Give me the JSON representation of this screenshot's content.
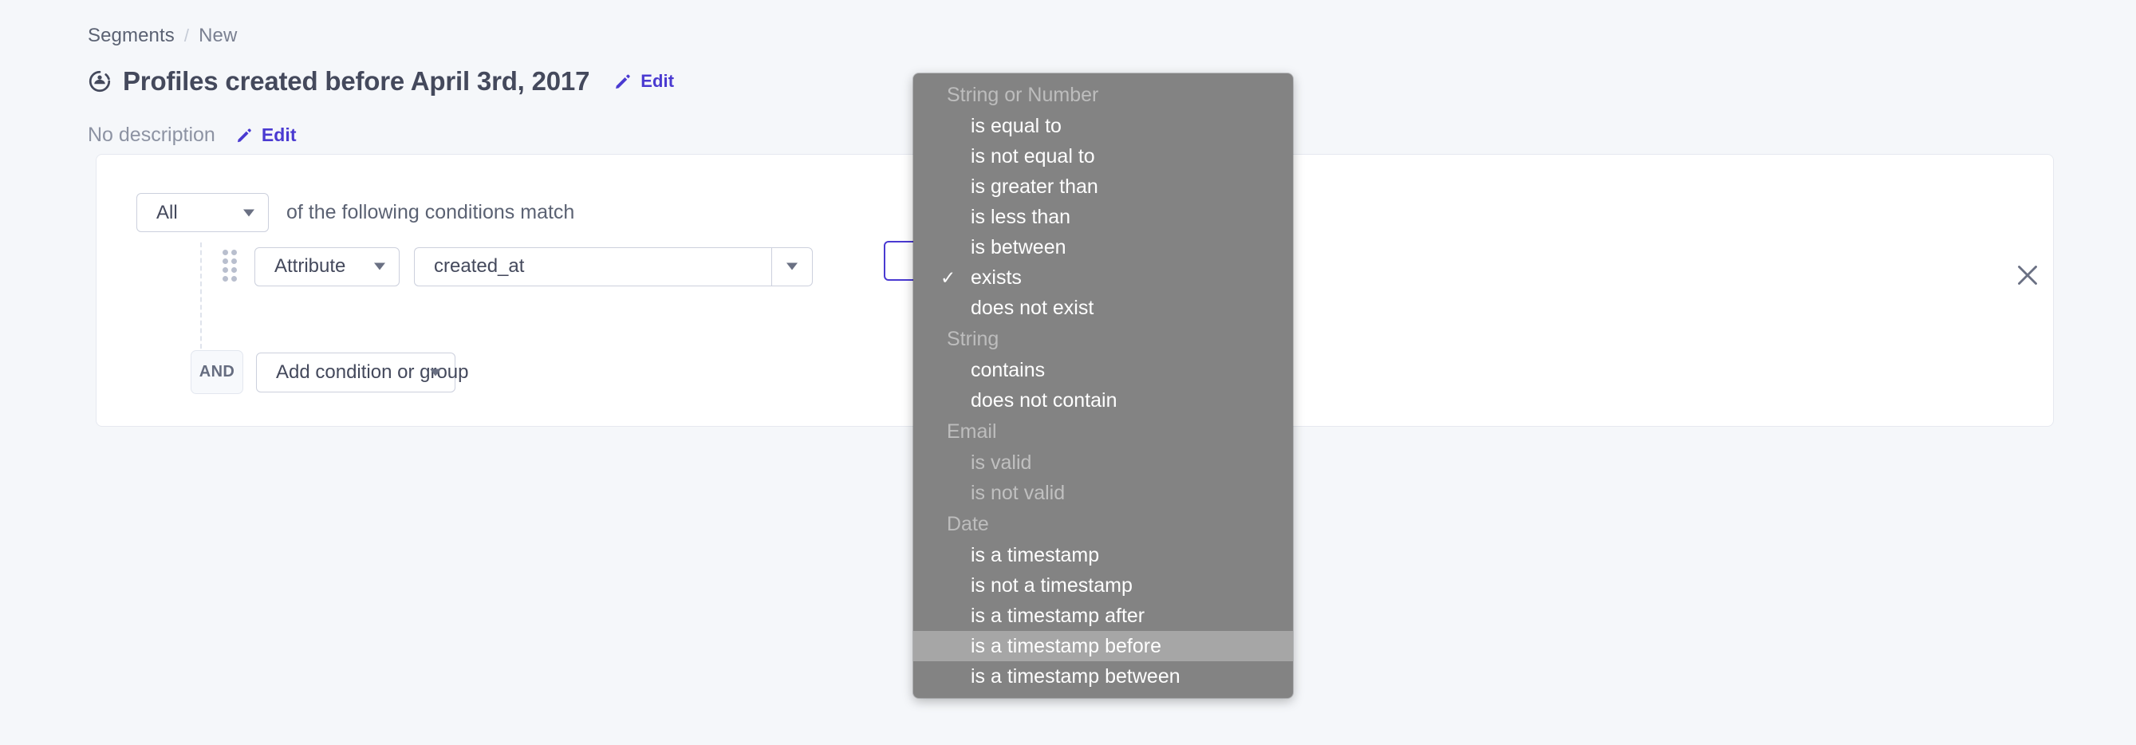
{
  "breadcrumb": {
    "parent": "Segments",
    "separator": "/",
    "current": "New"
  },
  "header": {
    "title": "Profiles created before April 3rd, 2017",
    "title_icon": "segment-circle-icon",
    "edit_label": "Edit",
    "edit_icon": "pencil-icon",
    "description": "No description",
    "description_edit_label": "Edit"
  },
  "builder": {
    "match_select_value": "All",
    "match_text": "of the following conditions match",
    "condition": {
      "type_select_value": "Attribute",
      "attribute_value": "created_at",
      "attribute_placeholder": "created_at",
      "operator_value": "",
      "remove_icon": "close-icon",
      "drag_icon": "drag-handle-icon"
    },
    "add_row": {
      "connector": "AND",
      "add_select_value": "Add condition or group"
    }
  },
  "operator_menu": {
    "sections": [
      {
        "label": "String or Number",
        "items": [
          {
            "label": "is equal to",
            "checked": false,
            "disabled": false,
            "highlighted": false
          },
          {
            "label": "is not equal to",
            "checked": false,
            "disabled": false,
            "highlighted": false
          },
          {
            "label": "is greater than",
            "checked": false,
            "disabled": false,
            "highlighted": false
          },
          {
            "label": "is less than",
            "checked": false,
            "disabled": false,
            "highlighted": false
          },
          {
            "label": "is between",
            "checked": false,
            "disabled": false,
            "highlighted": false
          },
          {
            "label": "exists",
            "checked": true,
            "disabled": false,
            "highlighted": false
          },
          {
            "label": "does not exist",
            "checked": false,
            "disabled": false,
            "highlighted": false
          }
        ]
      },
      {
        "label": "String",
        "items": [
          {
            "label": "contains",
            "checked": false,
            "disabled": false,
            "highlighted": false
          },
          {
            "label": "does not contain",
            "checked": false,
            "disabled": false,
            "highlighted": false
          }
        ]
      },
      {
        "label": "Email",
        "items": [
          {
            "label": "is valid",
            "checked": false,
            "disabled": true,
            "highlighted": false
          },
          {
            "label": "is not valid",
            "checked": false,
            "disabled": true,
            "highlighted": false
          }
        ]
      },
      {
        "label": "Date",
        "items": [
          {
            "label": "is a timestamp",
            "checked": false,
            "disabled": false,
            "highlighted": false
          },
          {
            "label": "is not a timestamp",
            "checked": false,
            "disabled": false,
            "highlighted": false
          },
          {
            "label": "is a timestamp after",
            "checked": false,
            "disabled": false,
            "highlighted": false
          },
          {
            "label": "is a timestamp before",
            "checked": false,
            "disabled": false,
            "highlighted": true
          },
          {
            "label": "is a timestamp between",
            "checked": false,
            "disabled": false,
            "highlighted": false
          }
        ]
      }
    ],
    "check_glyph": "✓"
  },
  "colors": {
    "page_bg": "#f5f7fa",
    "accent": "#4a3ad1",
    "text": "#44495c",
    "muted": "#8d93a3",
    "menu_bg": "#838383",
    "menu_highlight": "#a6a6a6"
  }
}
